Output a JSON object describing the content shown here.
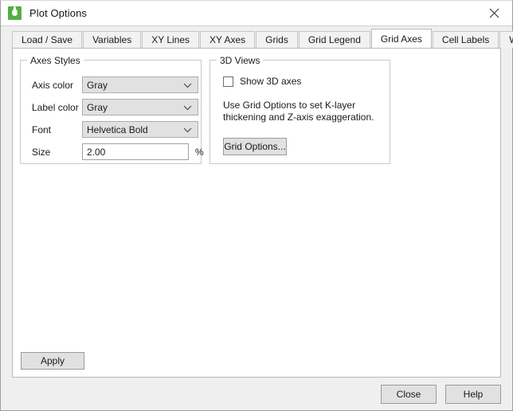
{
  "window": {
    "title": "Plot Options",
    "icon": "app-droplet-icon",
    "close_icon": "close-icon"
  },
  "tabs": [
    {
      "label": "Load / Save",
      "active": false
    },
    {
      "label": "Variables",
      "active": false
    },
    {
      "label": "XY Lines",
      "active": false
    },
    {
      "label": "XY Axes",
      "active": false
    },
    {
      "label": "Grids",
      "active": false
    },
    {
      "label": "Grid Legend",
      "active": false
    },
    {
      "label": "Grid Axes",
      "active": true
    },
    {
      "label": "Cell Labels",
      "active": false
    },
    {
      "label": "Wells",
      "active": false
    }
  ],
  "axes_styles": {
    "title": "Axes Styles",
    "axis_color": {
      "label": "Axis color",
      "value": "Gray"
    },
    "label_color": {
      "label": "Label color",
      "value": "Gray"
    },
    "font": {
      "label": "Font",
      "value": "Helvetica Bold"
    },
    "size": {
      "label": "Size",
      "value": "2.00",
      "unit": "%"
    }
  },
  "views_3d": {
    "title": "3D Views",
    "show_3d_axes": {
      "label": "Show 3D axes",
      "checked": false
    },
    "hint": "Use Grid Options to set K-layer thickening and Z-axis exaggeration.",
    "grid_options_button": "Grid Options..."
  },
  "actions": {
    "apply": "Apply",
    "close": "Close",
    "help": "Help"
  },
  "colors": {
    "accent": "#52b043",
    "panel_bg": "#ffffff",
    "window_bg": "#efefef",
    "control_bg": "#e1e1e1",
    "border": "#b9b9b9"
  }
}
